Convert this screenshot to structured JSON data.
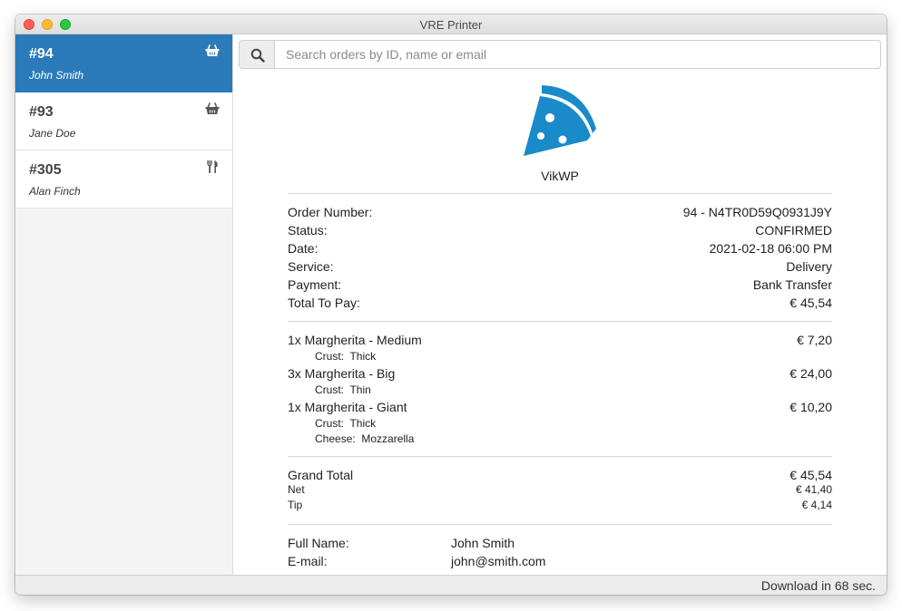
{
  "window": {
    "title": "VRE Printer"
  },
  "sidebar": {
    "orders": [
      {
        "number": "#94",
        "name": "John Smith",
        "icon": "basket-icon",
        "active": true
      },
      {
        "number": "#93",
        "name": "Jane Doe",
        "icon": "basket-icon",
        "active": false
      },
      {
        "number": "#305",
        "name": "Alan Finch",
        "icon": "cutlery-icon",
        "active": false
      }
    ]
  },
  "search": {
    "placeholder": "Search orders by ID, name or email",
    "value": ""
  },
  "receipt": {
    "brand": "VikWP",
    "logo_icon": "pizza-slice-icon",
    "accent_color": "#1a8ac9",
    "details": [
      {
        "label": "Order Number:",
        "value": "94 - N4TR0D59Q0931J9Y"
      },
      {
        "label": "Status:",
        "value": "CONFIRMED"
      },
      {
        "label": "Date:",
        "value": "2021-02-18 06:00 PM"
      },
      {
        "label": "Service:",
        "value": "Delivery"
      },
      {
        "label": "Payment:",
        "value": "Bank Transfer"
      },
      {
        "label": "Total To Pay:",
        "value": "€ 45,54"
      }
    ],
    "items": [
      {
        "name": "1x Margherita - Medium",
        "price": "€ 7,20",
        "options": [
          {
            "label": "Crust:",
            "value": "Thick"
          }
        ]
      },
      {
        "name": "3x Margherita - Big",
        "price": "€ 24,00",
        "options": [
          {
            "label": "Crust:",
            "value": "Thin"
          }
        ]
      },
      {
        "name": "1x Margherita - Giant",
        "price": "€ 10,20",
        "options": [
          {
            "label": "Crust:",
            "value": "Thick"
          },
          {
            "label": "Cheese:",
            "value": "Mozzarella"
          }
        ]
      }
    ],
    "totals": {
      "grand_label": "Grand Total",
      "grand_value": "€ 45,54",
      "net_label": "Net",
      "net_value": "€ 41,40",
      "tip_label": "Tip",
      "tip_value": "€ 4,14"
    },
    "customer": [
      {
        "label": "Full Name:",
        "value": "John Smith"
      },
      {
        "label": "E-mail:",
        "value": "john@smith.com"
      }
    ]
  },
  "status_bar": {
    "text": "Download in 68 sec."
  }
}
